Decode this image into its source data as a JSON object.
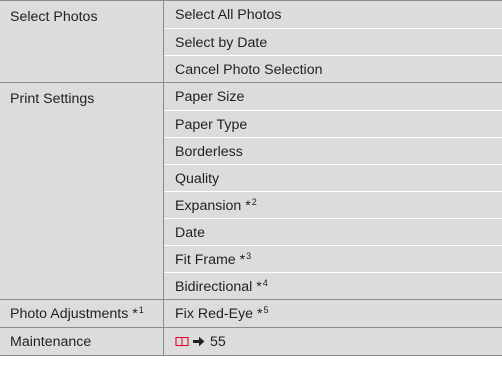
{
  "sections": [
    {
      "label": "Select Photos",
      "items": [
        {
          "label": "Select All Photos"
        },
        {
          "label": "Select by Date"
        },
        {
          "label": "Cancel Photo Selection"
        }
      ]
    },
    {
      "label": "Print Settings",
      "items": [
        {
          "label": "Paper Size"
        },
        {
          "label": "Paper Type"
        },
        {
          "label": "Borderless"
        },
        {
          "label": "Quality"
        },
        {
          "label": "Expansion *",
          "note": "2"
        },
        {
          "label": "Date"
        },
        {
          "label": "Fit Frame *",
          "note": "3"
        },
        {
          "label": "Bidirectional *",
          "note": "4"
        }
      ]
    },
    {
      "label": "Photo Adjustments *",
      "label_note": "1",
      "items": [
        {
          "label": "Fix Red-Eye *",
          "note": "5"
        }
      ]
    },
    {
      "label": "Maintenance",
      "items": [
        {
          "page_ref": "55",
          "icon": "book-icon",
          "arrow": "arrow-right-icon"
        }
      ]
    }
  ],
  "colors": {
    "cell_bg": "#dcdcdc",
    "border": "#8c8c8c",
    "icon_red": "#e4002b",
    "text": "#231f20"
  }
}
